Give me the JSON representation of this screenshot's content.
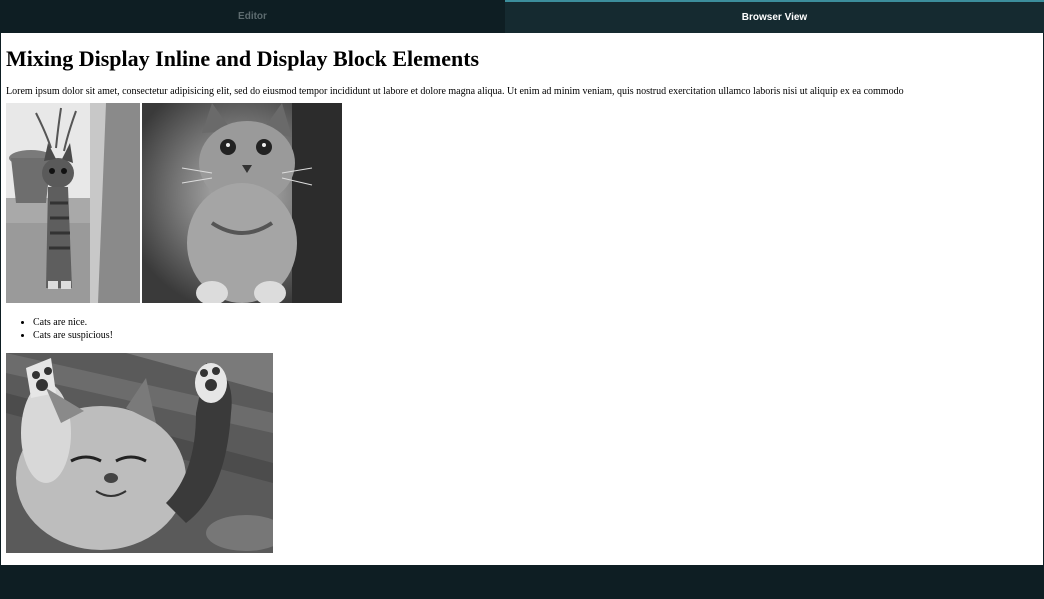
{
  "tabs": {
    "editor_label": "Editor",
    "browser_label": "Browser View"
  },
  "page": {
    "heading": "Mixing Display Inline and Display Block Elements",
    "paragraph": "Lorem ipsum dolor sit amet, consectetur adipisicing elit, sed do eiusmod tempor incididunt ut labore et dolore magna aliqua. Ut enim ad minim veniam, quis nostrud exercitation ullamco laboris nisi ut aliquip ex ea commodo",
    "list": [
      "Cats are nice.",
      "Cats are suspicious!"
    ]
  },
  "colors": {
    "chrome_background": "#0e1e23",
    "active_tab": "#152a30",
    "active_tab_accent": "#3c8e9c",
    "inactive_tab_text": "#5d6b6f"
  }
}
